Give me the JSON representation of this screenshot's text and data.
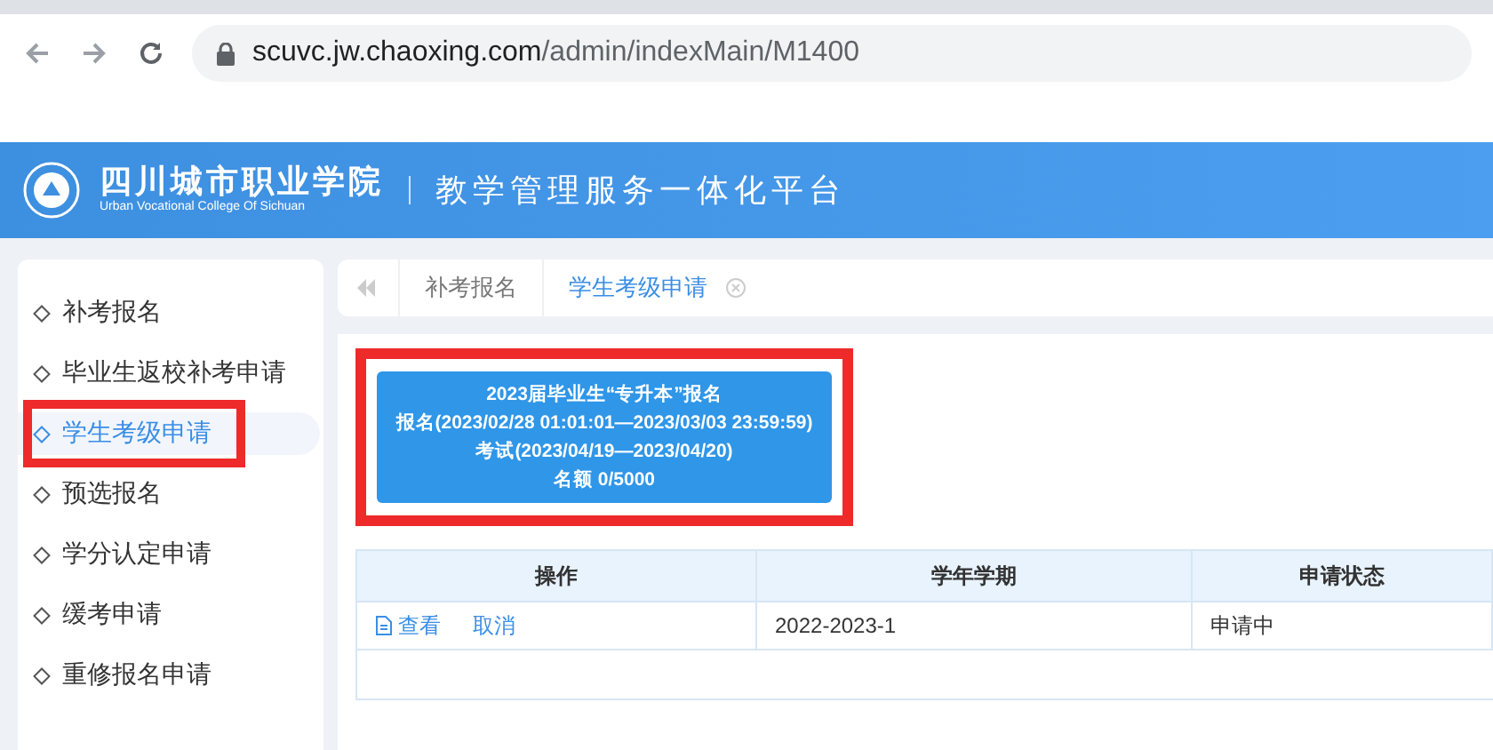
{
  "browser": {
    "url_host": "scuvc.jw.chaoxing.com",
    "url_path": "/admin/indexMain/M1400"
  },
  "header": {
    "school_name": "四川城市职业学院",
    "school_name_en": "Urban Vocational College Of Sichuan",
    "platform_title": "教学管理服务一体化平台"
  },
  "sidebar": {
    "items": [
      {
        "label": "补考报名",
        "selected": false,
        "highlighted": false
      },
      {
        "label": "毕业生返校补考申请",
        "selected": false,
        "highlighted": false
      },
      {
        "label": "学生考级申请",
        "selected": true,
        "highlighted": true
      },
      {
        "label": "预选报名",
        "selected": false,
        "highlighted": false
      },
      {
        "label": "学分认定申请",
        "selected": false,
        "highlighted": false
      },
      {
        "label": "缓考申请",
        "selected": false,
        "highlighted": false
      },
      {
        "label": "重修报名申请",
        "selected": false,
        "highlighted": false
      }
    ]
  },
  "tabs": [
    {
      "label": "补考报名",
      "selected": false,
      "closable": false
    },
    {
      "label": "学生考级申请",
      "selected": true,
      "closable": true
    }
  ],
  "exam_card": {
    "highlighted": true,
    "lines": [
      "2023届毕业生“专升本”报名",
      "报名(2023/02/28 01:01:01—2023/03/03 23:59:59)",
      "考试(2023/04/19—2023/04/20)",
      "名额 0/5000"
    ]
  },
  "table": {
    "columns": [
      "操作",
      "学年学期",
      "申请状态"
    ],
    "rows": [
      {
        "actions": [
          "查看",
          "取消"
        ],
        "term": "2022-2023-1",
        "status": "申请中"
      }
    ]
  }
}
